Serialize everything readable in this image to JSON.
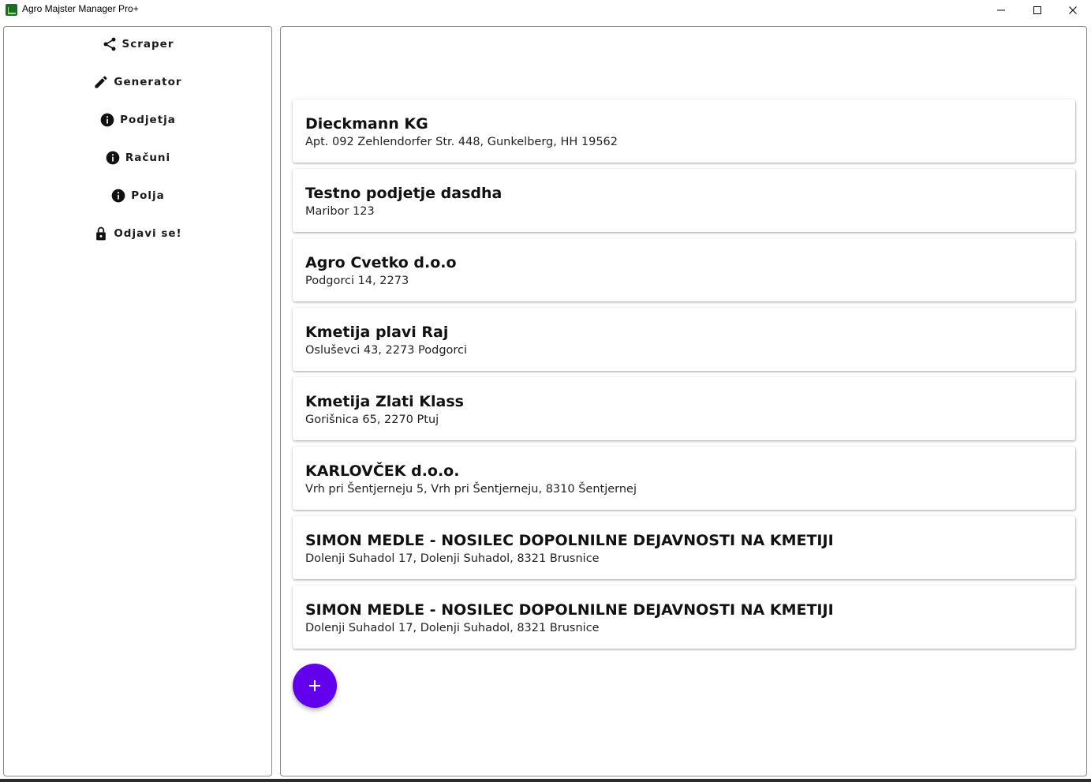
{
  "window": {
    "title": "Agro Majster Manager Pro+",
    "app_icon": "app-logo-icon"
  },
  "sidebar": {
    "items": [
      {
        "label": "Scraper",
        "icon": "share-icon"
      },
      {
        "label": "Generator",
        "icon": "pencil-icon"
      },
      {
        "label": "Podjetja",
        "icon": "info-icon"
      },
      {
        "label": "Računi",
        "icon": "info-icon"
      },
      {
        "label": "Polja",
        "icon": "info-icon"
      },
      {
        "label": "Odjavi se!",
        "icon": "lock-icon"
      }
    ]
  },
  "companies": [
    {
      "name": "Dieckmann KG",
      "address": "Apt. 092 Zehlendorfer Str. 448, Gunkelberg, HH 19562"
    },
    {
      "name": "Testno podjetje dasdha",
      "address": "Maribor 123"
    },
    {
      "name": "Agro Cvetko d.o.o",
      "address": "Podgorci 14, 2273"
    },
    {
      "name": "Kmetija plavi Raj",
      "address": "Osluševci 43, 2273 Podgorci"
    },
    {
      "name": "Kmetija Zlati Klass",
      "address": "Gorišnica 65, 2270 Ptuj"
    },
    {
      "name": "KARLOVČEK d.o.o.",
      "address": "Vrh pri Šentjerneju 5, Vrh pri Šentjerneju, 8310 Šentjernej"
    },
    {
      "name": "SIMON MEDLE - NOSILEC DOPOLNILNE DEJAVNOSTI NA KMETIJI",
      "address": "Dolenji Suhadol 17, Dolenji Suhadol, 8321 Brusnice"
    },
    {
      "name": "SIMON MEDLE - NOSILEC DOPOLNILNE DEJAVNOSTI NA KMETIJI",
      "address": "Dolenji Suhadol 17, Dolenji Suhadol, 8321 Brusnice"
    }
  ],
  "fab": {
    "icon": "plus-icon"
  },
  "colors": {
    "accent": "#6200ee",
    "border": "#8a8a8a"
  }
}
